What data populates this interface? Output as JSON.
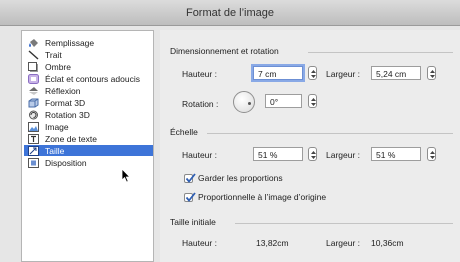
{
  "window": {
    "title": "Format de l’image"
  },
  "sidebar": {
    "items": [
      {
        "label": "Remplissage",
        "icon": "paint-bucket-icon",
        "selected": false
      },
      {
        "label": "Trait",
        "icon": "line-icon",
        "selected": false
      },
      {
        "label": "Ombre",
        "icon": "shadow-icon",
        "selected": false
      },
      {
        "label": "Éclat et contours adoucis",
        "icon": "glow-icon",
        "selected": false
      },
      {
        "label": "Réflexion",
        "icon": "reflection-icon",
        "selected": false
      },
      {
        "label": "Format 3D",
        "icon": "format-3d-icon",
        "selected": false
      },
      {
        "label": "Rotation 3D",
        "icon": "rotation-3d-icon",
        "selected": false
      },
      {
        "label": "Image",
        "icon": "image-icon",
        "selected": false
      },
      {
        "label": "Zone de texte",
        "icon": "text-box-icon",
        "selected": false
      },
      {
        "label": "Taille",
        "icon": "size-icon",
        "selected": true
      },
      {
        "label": "Disposition",
        "icon": "layout-icon",
        "selected": false
      }
    ]
  },
  "sizing": {
    "title": "Dimensionnement et rotation",
    "height_label": "Hauteur :",
    "height_value": "7 cm",
    "width_label": "Largeur :",
    "width_value": "5,24 cm",
    "rotation_label": "Rotation :",
    "rotation_value": "0°"
  },
  "scale": {
    "title": "Échelle",
    "height_label": "Hauteur :",
    "height_value": "51 %",
    "width_label": "Largeur :",
    "width_value": "51 %",
    "lock_aspect_label": "Garder les proportions",
    "lock_aspect_checked": true,
    "relative_label": "Proportionnelle à l’image d’origine",
    "relative_checked": true
  },
  "original": {
    "title": "Taille initiale",
    "height_label": "Hauteur :",
    "height_value": "13,82cm",
    "width_label": "Largeur :",
    "width_value": "10,36cm"
  },
  "colors": {
    "selection": "#3d74d8",
    "focus_ring": "#89a9e6",
    "check": "#2f5fb3"
  }
}
